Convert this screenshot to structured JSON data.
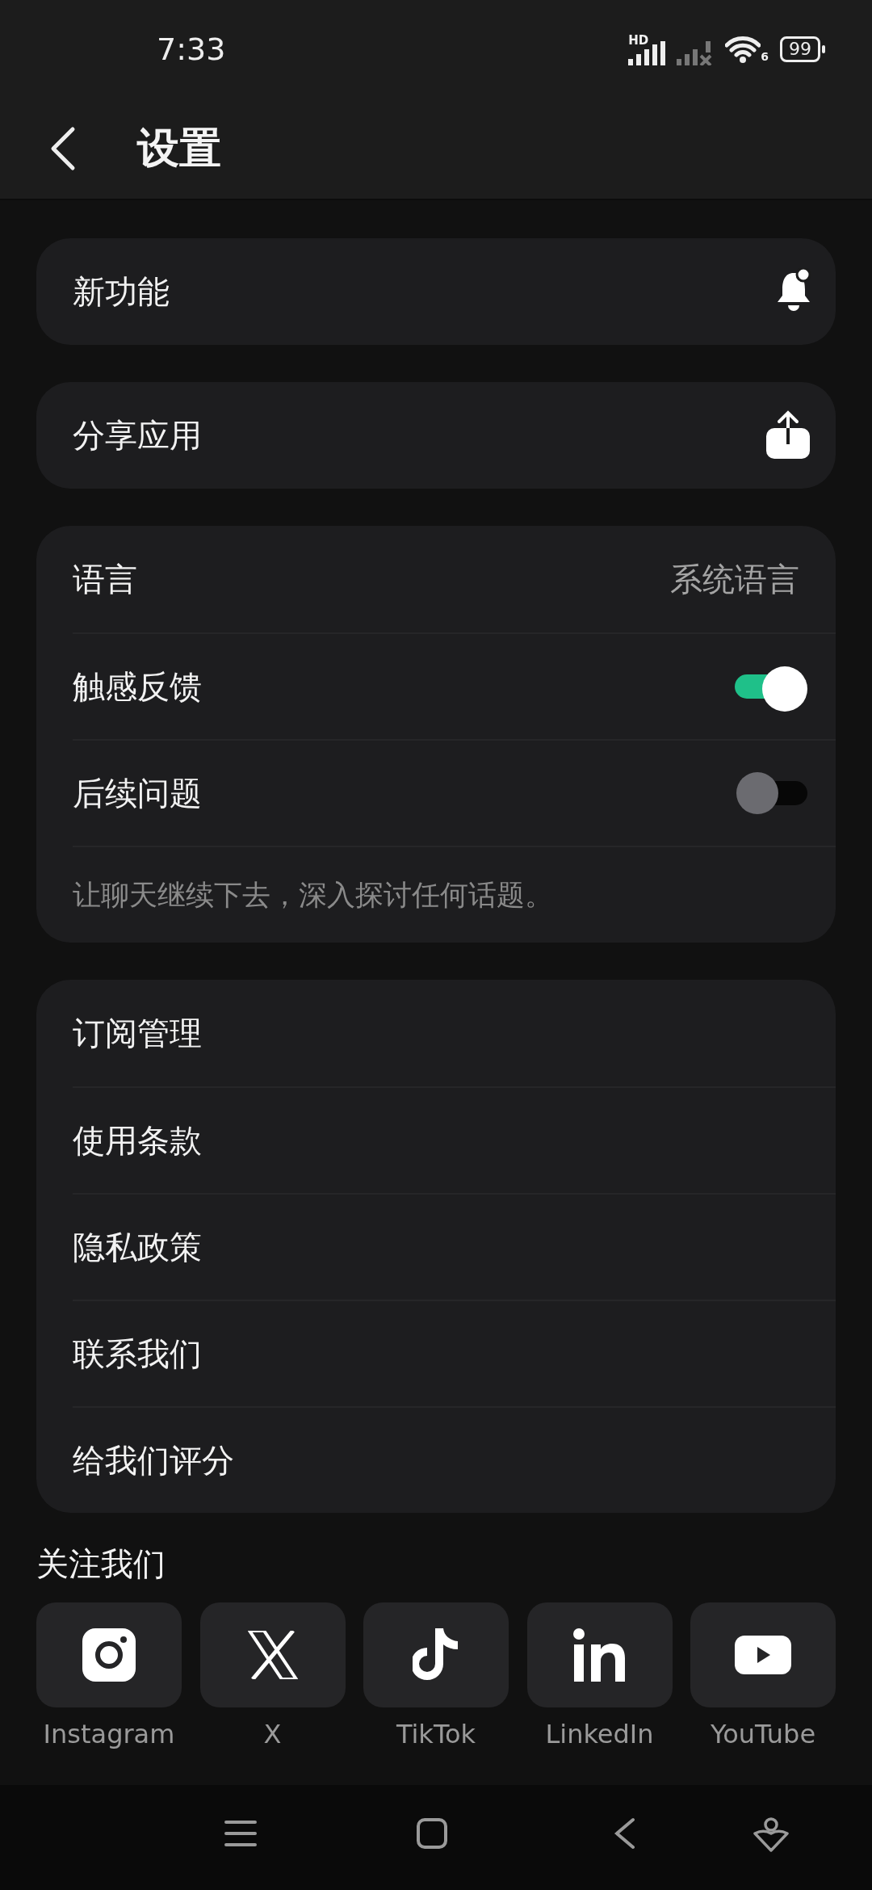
{
  "status_bar": {
    "time": "7:33",
    "network_label": "HD",
    "wifi_label": "6",
    "battery": "99"
  },
  "header": {
    "title": "设置"
  },
  "groups": [
    {
      "items": [
        {
          "kind": "bell",
          "label": "新功能"
        }
      ]
    },
    {
      "items": [
        {
          "kind": "share",
          "label": "分享应用"
        }
      ]
    },
    {
      "items": [
        {
          "kind": "value",
          "label": "语言",
          "value": "系统语言"
        },
        {
          "kind": "toggle",
          "label": "触感反馈",
          "on": true
        },
        {
          "kind": "toggle",
          "label": "后续问题",
          "on": false
        },
        {
          "kind": "note",
          "label": "让聊天继续下去，深入探讨任何话题。"
        }
      ]
    },
    {
      "items": [
        {
          "kind": "link",
          "label": "订阅管理"
        },
        {
          "kind": "link",
          "label": "使用条款"
        },
        {
          "kind": "link",
          "label": "隐私政策"
        },
        {
          "kind": "link",
          "label": "联系我们"
        },
        {
          "kind": "link",
          "label": "给我们评分"
        }
      ]
    }
  ],
  "follow": {
    "title": "关注我们",
    "links": [
      {
        "kind": "instagram",
        "label": "Instagram"
      },
      {
        "kind": "x",
        "label": "X"
      },
      {
        "kind": "tiktok",
        "label": "TikTok"
      },
      {
        "kind": "linkedin",
        "label": "LinkedIn"
      },
      {
        "kind": "youtube",
        "label": "YouTube"
      }
    ]
  }
}
